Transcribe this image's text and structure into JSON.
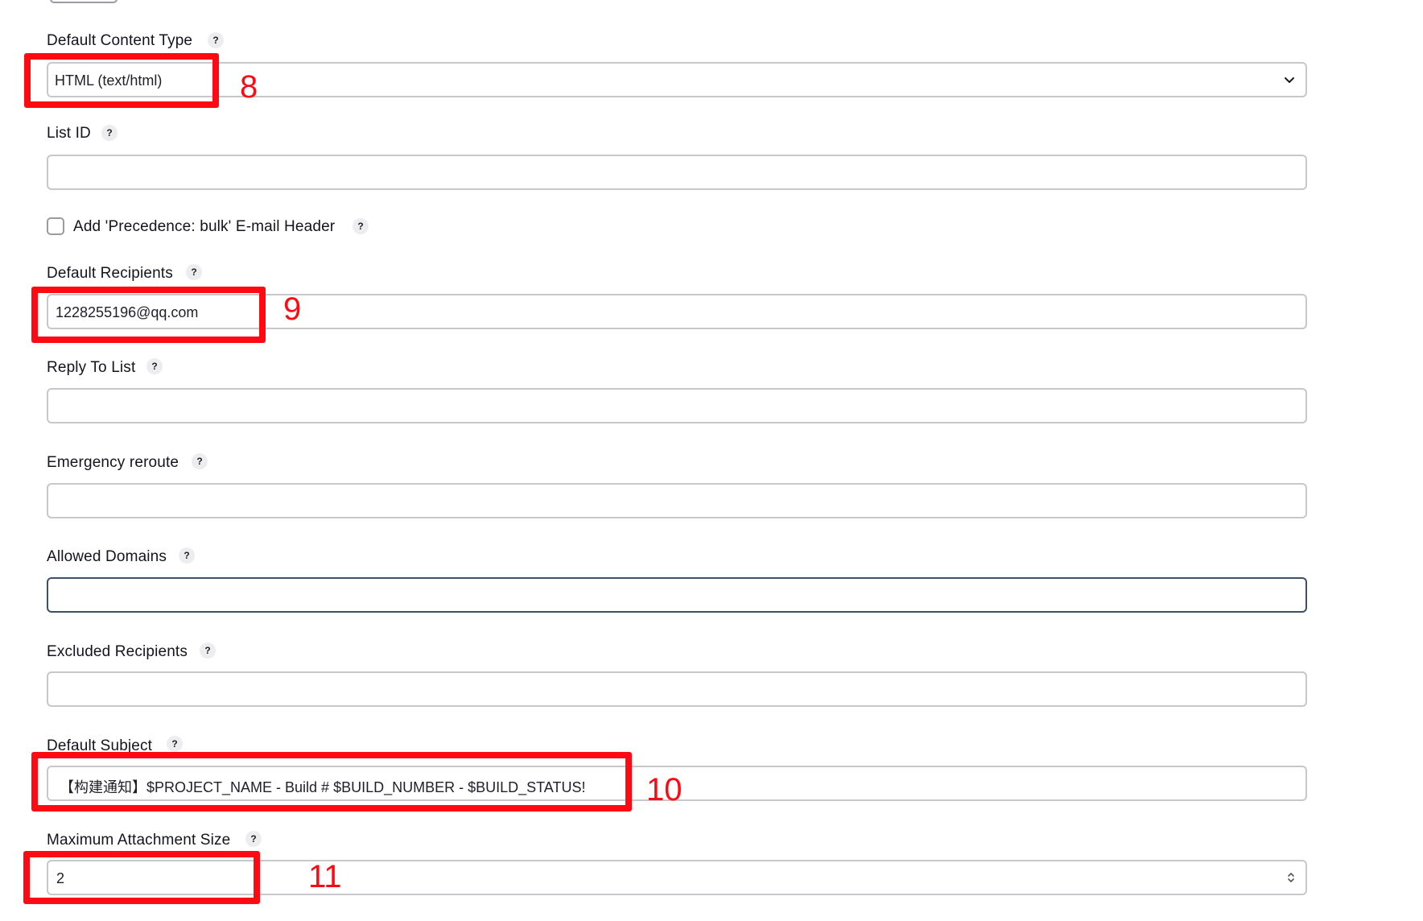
{
  "fields": {
    "content_type": {
      "label": "Default Content Type",
      "value": "HTML (text/html)"
    },
    "list_id": {
      "label": "List ID",
      "value": ""
    },
    "precedence": {
      "label": "Add 'Precedence: bulk' E-mail Header",
      "checked": false
    },
    "recipients": {
      "label": "Default Recipients",
      "value": "1228255196@qq.com"
    },
    "reply_to": {
      "label": "Reply To List",
      "value": ""
    },
    "emergency": {
      "label": "Emergency reroute",
      "value": ""
    },
    "domains": {
      "label": "Allowed Domains",
      "value": ""
    },
    "excluded": {
      "label": "Excluded Recipients",
      "value": ""
    },
    "subject": {
      "label": "Default Subject",
      "value": "【构建通知】$PROJECT_NAME - Build # $BUILD_NUMBER - $BUILD_STATUS!"
    },
    "attachment": {
      "label": "Maximum Attachment Size",
      "value": "2"
    }
  },
  "help_glyph": "?",
  "annotations": {
    "a8": "8",
    "a9": "9",
    "a10": "10",
    "a11": "11"
  },
  "colors": {
    "highlight": "#ff0a12",
    "field_border": "#c7c7cc",
    "focus_border": "#3d5067"
  },
  "icons": {
    "select_arrow": "chevron-down-icon",
    "stepper": "stepper-arrows-icon"
  }
}
